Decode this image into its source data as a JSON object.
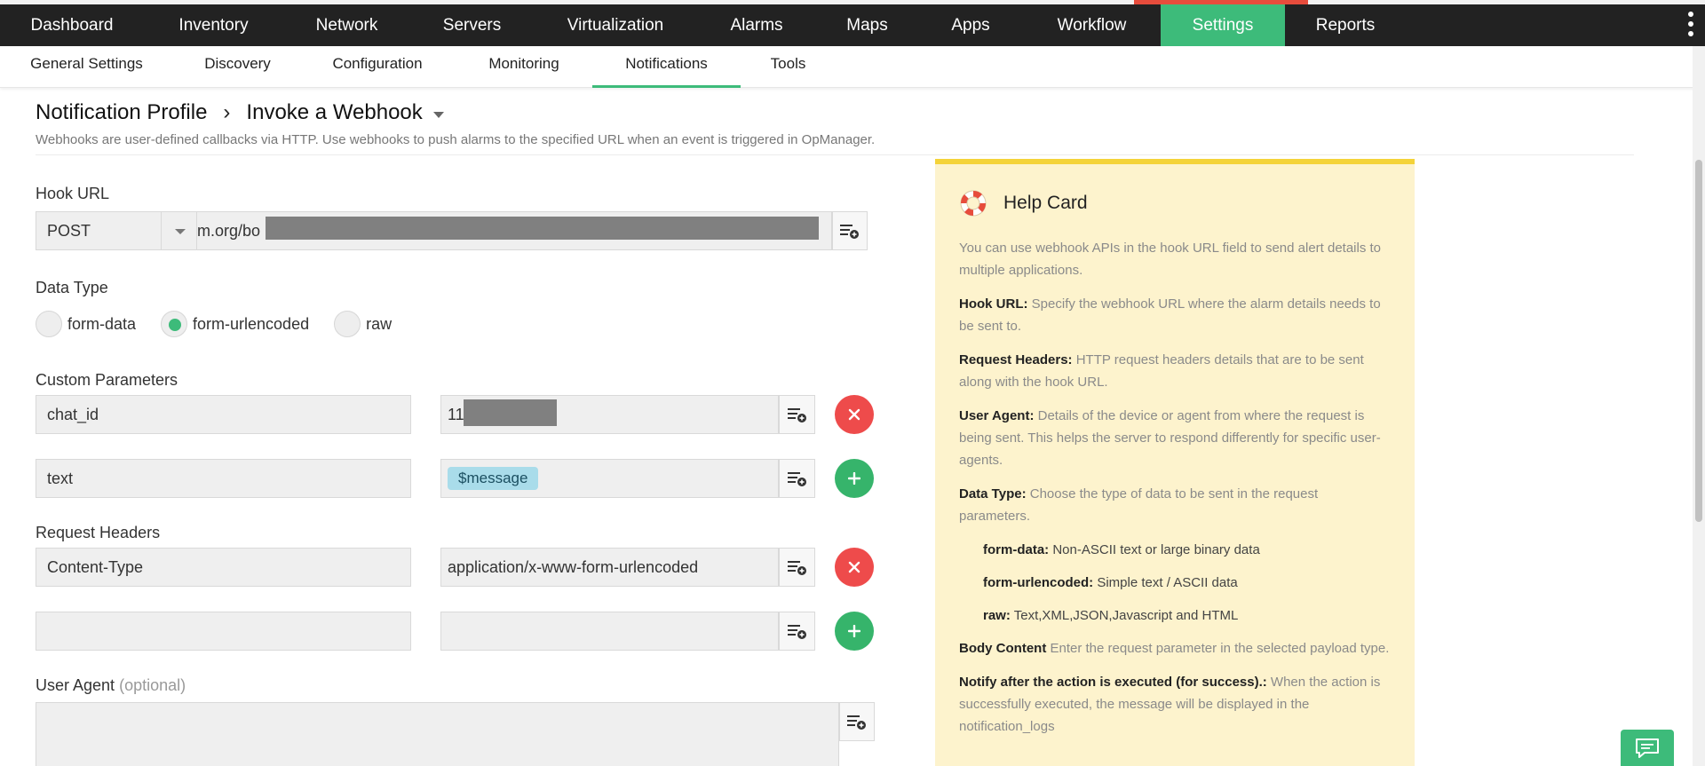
{
  "topnav": {
    "items": [
      {
        "label": "Dashboard"
      },
      {
        "label": "Inventory"
      },
      {
        "label": "Network"
      },
      {
        "label": "Servers"
      },
      {
        "label": "Virtualization"
      },
      {
        "label": "Alarms"
      },
      {
        "label": "Maps"
      },
      {
        "label": "Apps"
      },
      {
        "label": "Workflow"
      },
      {
        "label": "Settings"
      },
      {
        "label": "Reports"
      }
    ],
    "active": "Settings",
    "accent": "#3dbb7a"
  },
  "subnav": {
    "items": [
      {
        "label": "General Settings"
      },
      {
        "label": "Discovery"
      },
      {
        "label": "Configuration"
      },
      {
        "label": "Monitoring"
      },
      {
        "label": "Notifications"
      },
      {
        "label": "Tools"
      }
    ],
    "active": "Notifications"
  },
  "header": {
    "breadcrumb_root": "Notification Profile",
    "breadcrumb_current": "Invoke a Webhook",
    "description": "Webhooks are user-defined callbacks via HTTP. Use webhooks to push alarms to the specified URL when an event is triggered in OpManager."
  },
  "form": {
    "hook_url": {
      "label": "Hook URL",
      "method": "POST",
      "url_visible": "m.org/bo"
    },
    "data_type": {
      "label": "Data Type",
      "options": [
        "form-data",
        "form-urlencoded",
        "raw"
      ],
      "selected": "form-urlencoded"
    },
    "custom_parameters": {
      "label": "Custom Parameters",
      "rows": [
        {
          "key": "chat_id",
          "value": "11"
        },
        {
          "key": "text",
          "value": "$message"
        }
      ]
    },
    "request_headers": {
      "label": "Request Headers",
      "rows": [
        {
          "key": "Content-Type",
          "value": "application/x-www-form-urlencoded"
        },
        {
          "key": "",
          "value": ""
        }
      ]
    },
    "user_agent": {
      "label": "User Agent",
      "optional": "(optional)",
      "value": ""
    }
  },
  "help_card": {
    "title": "Help Card",
    "intro": "You can use webhook APIs in the hook URL field to send alert details to multiple applications.",
    "entries": [
      {
        "term": "Hook URL:",
        "text": " Specify the webhook URL where the alarm details needs to be sent to."
      },
      {
        "term": "Request Headers:",
        "text": " HTTP request headers details that are to be sent along with the hook URL."
      },
      {
        "term": "User Agent:",
        "text": " Details of the device or agent from where the request is being sent. This helps the server to respond differently for specific user-agents."
      },
      {
        "term": "Data Type:",
        "text": " Choose the type of data to be sent in the request parameters."
      }
    ],
    "data_types": [
      {
        "term": "form-data:",
        "text": " Non-ASCII text or large binary data"
      },
      {
        "term": "form-urlencoded:",
        "text": " Simple text / ASCII data"
      },
      {
        "term": "raw:",
        "text": " Text,XML,JSON,Javascript and HTML"
      }
    ],
    "tail": [
      {
        "term": "Body Content",
        "text": " Enter the request parameter in the selected payload type."
      },
      {
        "term": "Notify after the action is executed (for success).:",
        "text": " When the action is successfully executed, the message will be displayed in the notification_logs"
      }
    ]
  }
}
